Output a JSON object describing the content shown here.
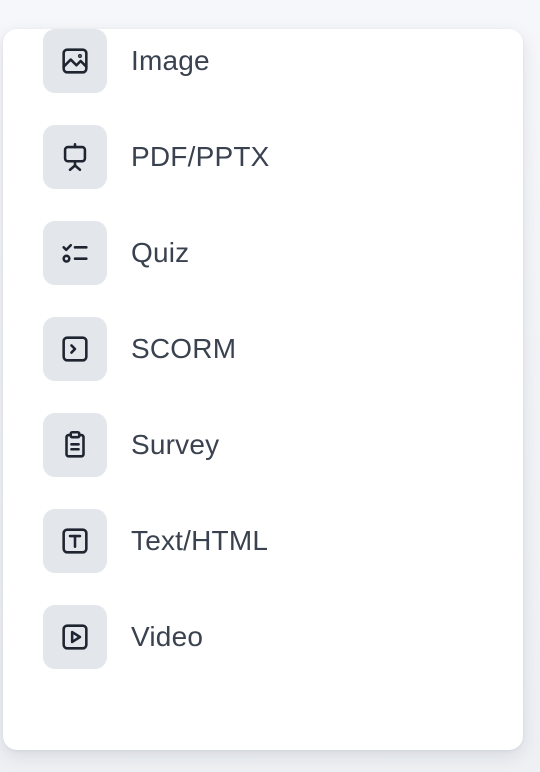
{
  "menu": {
    "items": [
      {
        "label": "Image",
        "icon": "image-icon"
      },
      {
        "label": "PDF/PPTX",
        "icon": "presentation-icon"
      },
      {
        "label": "Quiz",
        "icon": "checklist-icon"
      },
      {
        "label": "SCORM",
        "icon": "terminal-icon"
      },
      {
        "label": "Survey",
        "icon": "clipboard-icon"
      },
      {
        "label": "Text/HTML",
        "icon": "text-icon"
      },
      {
        "label": "Video",
        "icon": "play-icon"
      }
    ]
  }
}
